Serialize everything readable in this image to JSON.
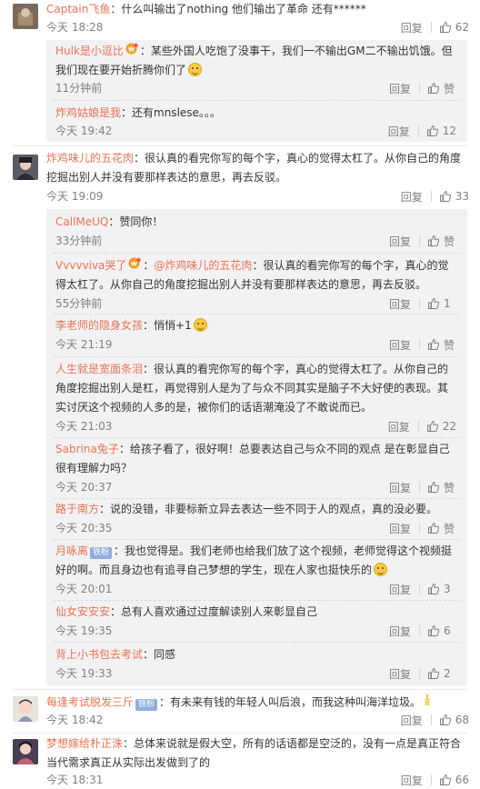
{
  "ui": {
    "reply_label": "回复",
    "like_label": "赞"
  },
  "comments": [
    {
      "user": "Captain飞鱼",
      "text": "：什么叫输出了nothing 他们输出了革命 还有******",
      "time": "今天 18:28",
      "likes": "62",
      "replies": [
        {
          "user": "Hulk是小逗比",
          "text": "：某些外国人吃饱了没事干，我们一不输出GM二不输出饥饿。但我们现在要开始折腾你们了",
          "time": "11分钟前",
          "likes": ""
        },
        {
          "user": "炸鸡姑娘是我",
          "text": "：还有mnslese。。。",
          "time": "今天 19:42",
          "likes": "12"
        }
      ]
    },
    {
      "user": "炸鸡味儿的五花肉",
      "text": "：很认真的看完你写的每个字，真心的觉得太杠了。从你自己的角度挖掘出别人并没有要那样表达的意思，再去反驳。",
      "time": "今天 19:09",
      "likes": "33",
      "replies": [
        {
          "user": "CallMeUQ",
          "text": "：赞同你！",
          "time": "33分钟前",
          "likes": ""
        },
        {
          "user": "Vvvvviva哭了",
          "mention": "@炸鸡味儿的五花肉",
          "text": "：很认真的看完你写的每个字，真心的觉得太杠了。从你自己的角度挖掘出别人并没有要那样表达的意思，再去反驳。",
          "time": "55分钟前",
          "likes": "1"
        },
        {
          "user": "李老师的隐身女孩",
          "text": "：悄悄+1",
          "time": "今天 21:19",
          "likes": ""
        },
        {
          "user": "人生就是宽面条泪",
          "text": "：很认真的看完你写的每个字，真心的觉得太杠了。从你自己的角度挖掘出别人是杠，再觉得别人是为了与众不同其实是脑子不大好使的表现。其实讨厌这个视频的人多的是，被你们的话语潮淹没了不敢说而已。",
          "time": "今天 21:03",
          "likes": "22"
        },
        {
          "user": "Sabrina兔子",
          "text": "：给孩子看了，很好啊！总要表达自己与众不同的观点 是在彰显自己很有理解力吗？",
          "time": "今天 20:37",
          "likes": ""
        },
        {
          "user": "路于南方",
          "text": "：说的没错，非要标新立异去表达一些不同于人的观点，真的没必要。",
          "time": "今天 20:35",
          "likes": ""
        },
        {
          "user": "月咏离",
          "badge": "铁粉",
          "text": "：我也觉得是。我们老师也给我们放了这个视频，老师觉得这个视频挺好的啊。而且身边也有追寻自己梦想的学生，现在人家也挺快乐的",
          "time": "今天 20:01",
          "likes": "3"
        },
        {
          "user": "仙女安安安",
          "text": "：总有人喜欢通过过度解读别人来彰显自己",
          "time": "今天 19:35",
          "likes": "6"
        },
        {
          "user": "背上小书包去考试",
          "text": "：同感",
          "time": "今天 19:33",
          "likes": "2"
        }
      ]
    },
    {
      "user": "每逢考试脱发三斤",
      "badge": "铁粉",
      "text": "：有未来有钱的年轻人叫后浪，而我这种叫海洋垃圾。",
      "time": "今天 18:42",
      "likes": "68",
      "replies": []
    },
    {
      "user": "梦想嫁给朴正洙",
      "text": "：总体来说就是假大空，所有的话语都是空泛的，没有一点是真正符合当代需求真正从实际出发做到了的",
      "time": "今天 18:31",
      "likes": "66",
      "replies": []
    }
  ],
  "colors": {
    "username": "#eb7350",
    "meta": "#808080",
    "reply_bg": "#f2f2f5",
    "badge": "#90aedc"
  }
}
